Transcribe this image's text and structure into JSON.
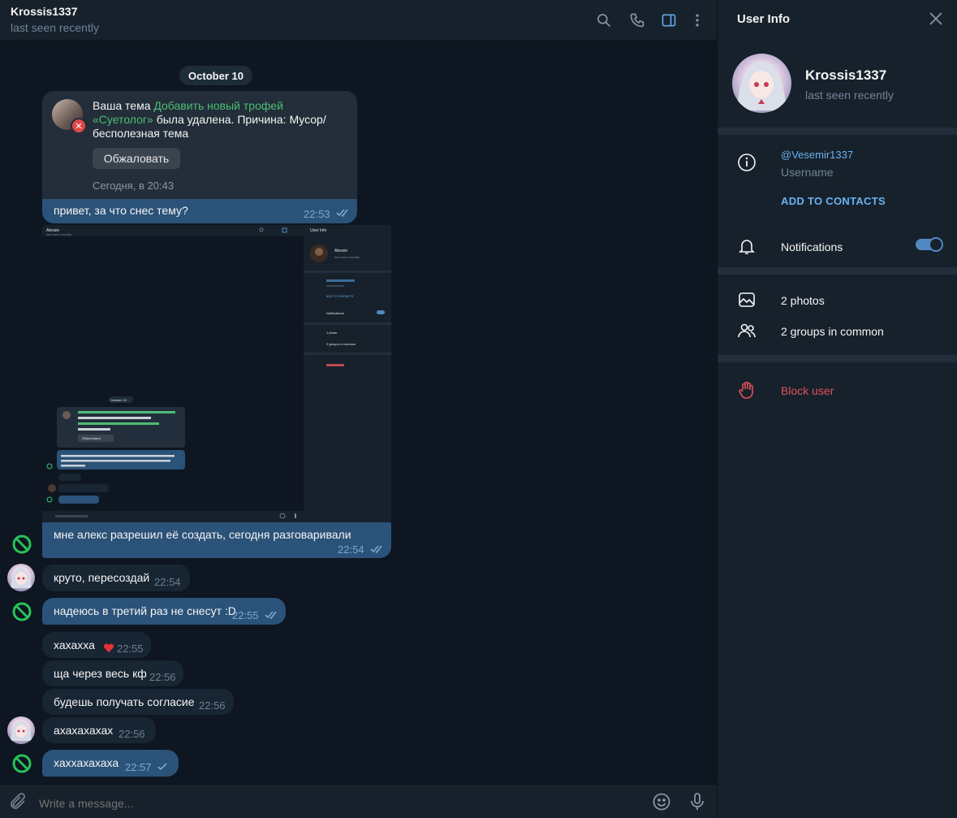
{
  "chat": {
    "title": "Krossis1337",
    "status": "last seen recently",
    "date": "October 10"
  },
  "forwarded": {
    "prefix": "Ваша тема ",
    "link": "Добавить новый трофей «Суетолог»",
    "suffix": " была удалена. Причина: Мусор/бесполезная тема",
    "button": "Обжаловать",
    "date": "Сегодня, в 20:43"
  },
  "messages": [
    {
      "text": "привет, за что снес тему?",
      "time": "22:53"
    },
    {
      "text": "мне алекс разрешил её создать, сегодня разговаривали",
      "time": "22:54"
    },
    {
      "text": "круто, пересоздай",
      "time": "22:54"
    },
    {
      "text": "надеюсь в третий раз не снесут :D",
      "time": "22:55"
    },
    {
      "text": "хахахха",
      "time": "22:55"
    },
    {
      "text": "ща через весь кф",
      "time": "22:56"
    },
    {
      "text": "будешь получать согласие",
      "time": "22:56"
    },
    {
      "text": "ахахахахах",
      "time": "22:56"
    },
    {
      "text": "хаххахахаха",
      "time": "22:57"
    }
  ],
  "screenshot": {
    "name": "Alexsie",
    "status": "last seen recently",
    "panel_title": "User Info",
    "add_contacts": "ADD TO CONTACTS",
    "notifications": "Notifications",
    "photos": "1 photo",
    "groups": "2 groups in common",
    "date": "October 10",
    "button": "Обжаловать"
  },
  "input": {
    "placeholder": "Write a message..."
  },
  "panel": {
    "title": "User Info",
    "name": "Krossis1337",
    "status": "last seen recently",
    "username": "@Vesemir1337",
    "username_label": "Username",
    "add_contacts": "ADD TO CONTACTS",
    "notifications": "Notifications",
    "photos": "2 photos",
    "groups": "2 groups in common",
    "block": "Block user"
  },
  "colors": {
    "background": "#0e1621",
    "header": "#17212b",
    "incoming": "#182533",
    "outgoing": "#2b5278",
    "accent": "#6ab2f2",
    "link_green": "#4dbd74",
    "danger": "#e0525a"
  },
  "icons": [
    "search-icon",
    "phone-icon",
    "sidebar-icon",
    "more-icon",
    "close-icon",
    "info-icon",
    "bell-icon",
    "photo-icon",
    "group-icon",
    "hand-icon",
    "attach-icon",
    "emoji-icon",
    "microphone-icon",
    "ban-icon",
    "double-check-icon",
    "heart-icon"
  ]
}
